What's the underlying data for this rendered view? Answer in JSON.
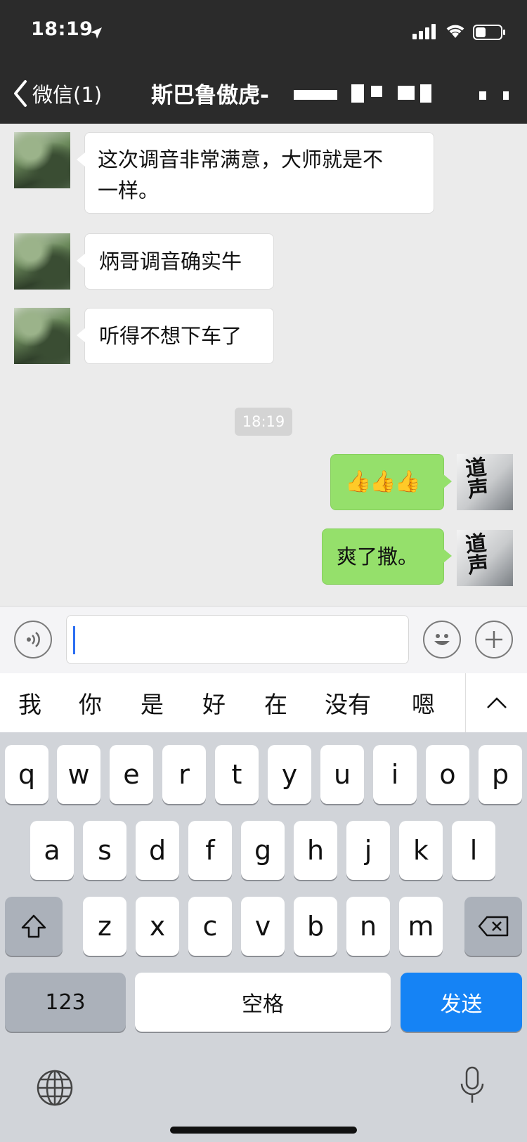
{
  "status_bar": {
    "time": "18:19"
  },
  "header": {
    "back_label": "微信(1)",
    "title": "斯巴鲁傲虎-"
  },
  "messages": [
    {
      "side": "left",
      "text_line1": "这次调音非常满意，大师就是不",
      "text_line2": "一样。"
    },
    {
      "side": "left",
      "text": "炳哥调音确实牛"
    },
    {
      "side": "left",
      "text": "听得不想下车了"
    },
    {
      "side": "right",
      "text": "👍👍👍"
    },
    {
      "side": "right",
      "text": "爽了撒。"
    }
  ],
  "timestamp": "18:19",
  "input": {
    "value": "",
    "placeholder": ""
  },
  "suggestions": [
    "我",
    "你",
    "是",
    "好",
    "在",
    "没有",
    "嗯"
  ],
  "keyboard": {
    "row1": [
      "q",
      "w",
      "e",
      "r",
      "t",
      "y",
      "u",
      "i",
      "o",
      "p"
    ],
    "row2": [
      "a",
      "s",
      "d",
      "f",
      "g",
      "h",
      "j",
      "k",
      "l"
    ],
    "row3": [
      "z",
      "x",
      "c",
      "v",
      "b",
      "n",
      "m"
    ],
    "numbers_key": "123",
    "space_key": "空格",
    "send_key": "发送"
  },
  "colors": {
    "header_bg": "#2b2b2b",
    "sent_bubble": "#95e06b",
    "received_bubble": "#ffffff",
    "send_key": "#1583f5"
  },
  "icons": [
    "location-arrow-icon",
    "signal-icon",
    "wifi-icon",
    "battery-icon",
    "back-chevron-icon",
    "voice-icon",
    "emoji-icon",
    "plus-icon",
    "chevron-up-icon",
    "shift-icon",
    "delete-icon",
    "globe-icon",
    "microphone-icon"
  ]
}
